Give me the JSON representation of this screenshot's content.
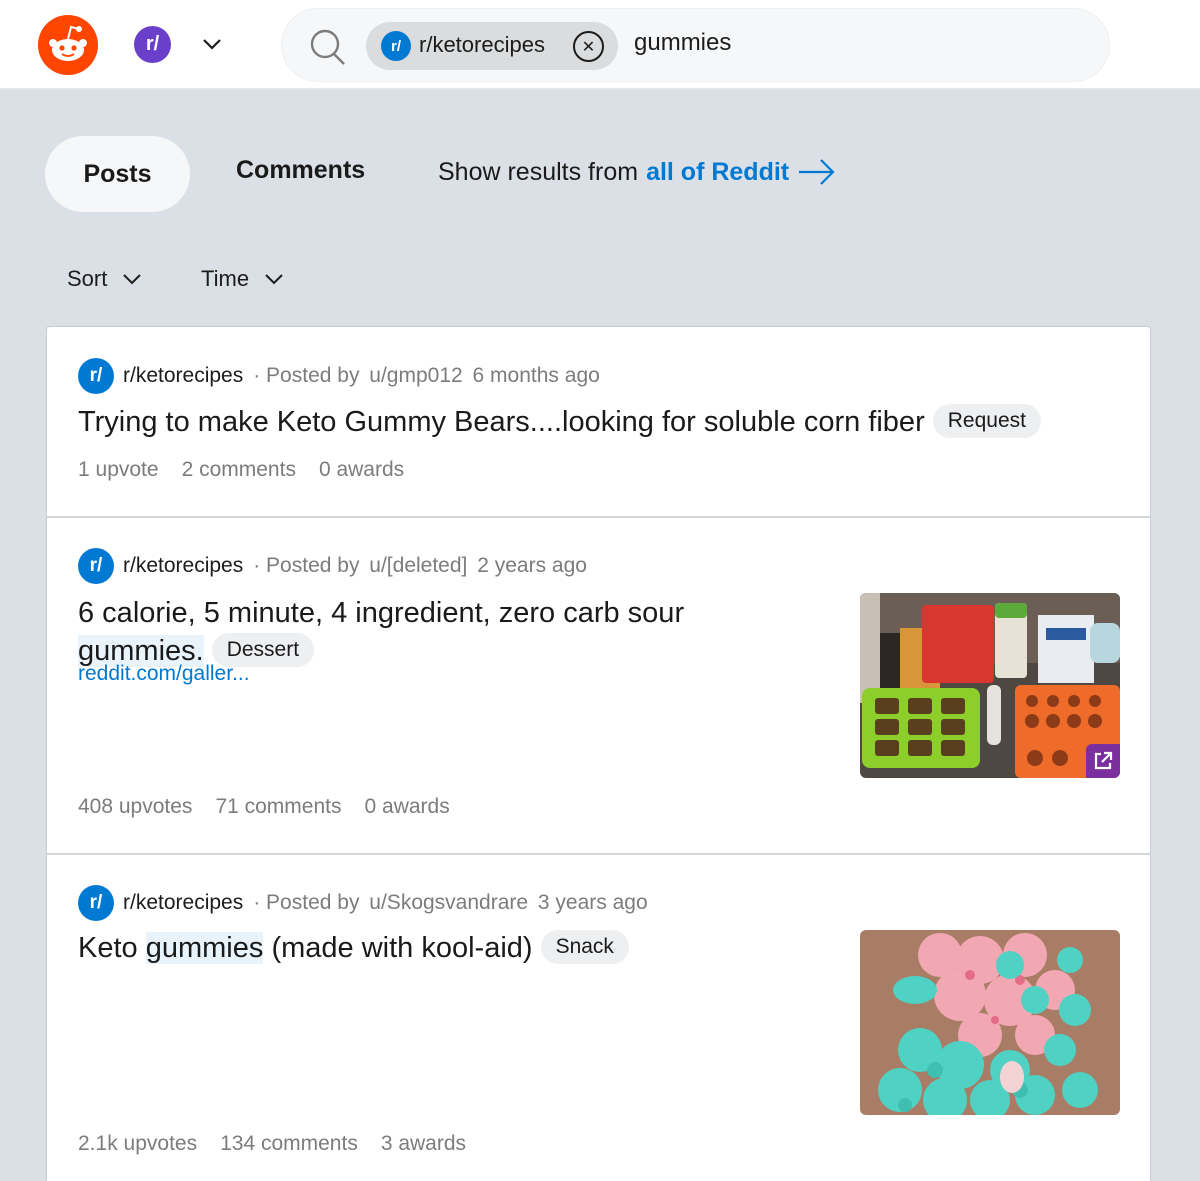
{
  "header": {
    "logo_icon": "reddit-snoo-icon",
    "community_icon_text": "r/",
    "community_chevron_icon": "chevron-down-icon",
    "search": {
      "icon": "search-icon",
      "chip": {
        "icon_text": "r/",
        "label": "r/ketorecipes",
        "close_icon": "close-circle-icon"
      },
      "query": "gummies"
    }
  },
  "tabs": {
    "posts": "Posts",
    "comments": "Comments",
    "show_results_prefix": "Show results from",
    "show_results_link": "all of Reddit",
    "arrow_icon": "arrow-right-icon"
  },
  "filters": {
    "sort": "Sort",
    "time": "Time"
  },
  "colors": {
    "brand": "#ff4500",
    "accent": "#0079d3",
    "community": "#6a3fc9",
    "background": "#dae0e6"
  },
  "posts": [
    {
      "subreddit_icon": "r/",
      "subreddit": "r/ketorecipes",
      "posted_by_label": "· Posted by",
      "author": "u/gmp012",
      "time": "6 months ago",
      "title": "Trying to make Keto Gummy Bears....looking for soluble corn fiber",
      "flair": "Request",
      "upvotes": "1 upvote",
      "comments": "2 comments",
      "awards": "0 awards"
    },
    {
      "subreddit_icon": "r/",
      "subreddit": "r/ketorecipes",
      "posted_by_label": "· Posted by",
      "author": "u/[deleted]",
      "time": "2 years ago",
      "title_before": "6 calorie, 5 minute, 4 ingredient, zero carb sour",
      "title_highlight": "gummies.",
      "flair": "Dessert",
      "link": "reddit.com/galler...",
      "thumbnail": "gummy-molds-ingredients-photo",
      "external_link_icon": "external-link-icon",
      "upvotes": "408 upvotes",
      "comments": "71 comments",
      "awards": "0 awards"
    },
    {
      "subreddit_icon": "r/",
      "subreddit": "r/ketorecipes",
      "posted_by_label": "· Posted by",
      "author": "u/Skogsvandrare",
      "time": "3 years ago",
      "title_before": "Keto",
      "title_highlight": "gummies",
      "title_after": "(made with kool-aid)",
      "flair": "Snack",
      "thumbnail": "pink-teal-gummies-photo",
      "upvotes": "2.1k upvotes",
      "comments": "134 comments",
      "awards": "3 awards"
    }
  ]
}
